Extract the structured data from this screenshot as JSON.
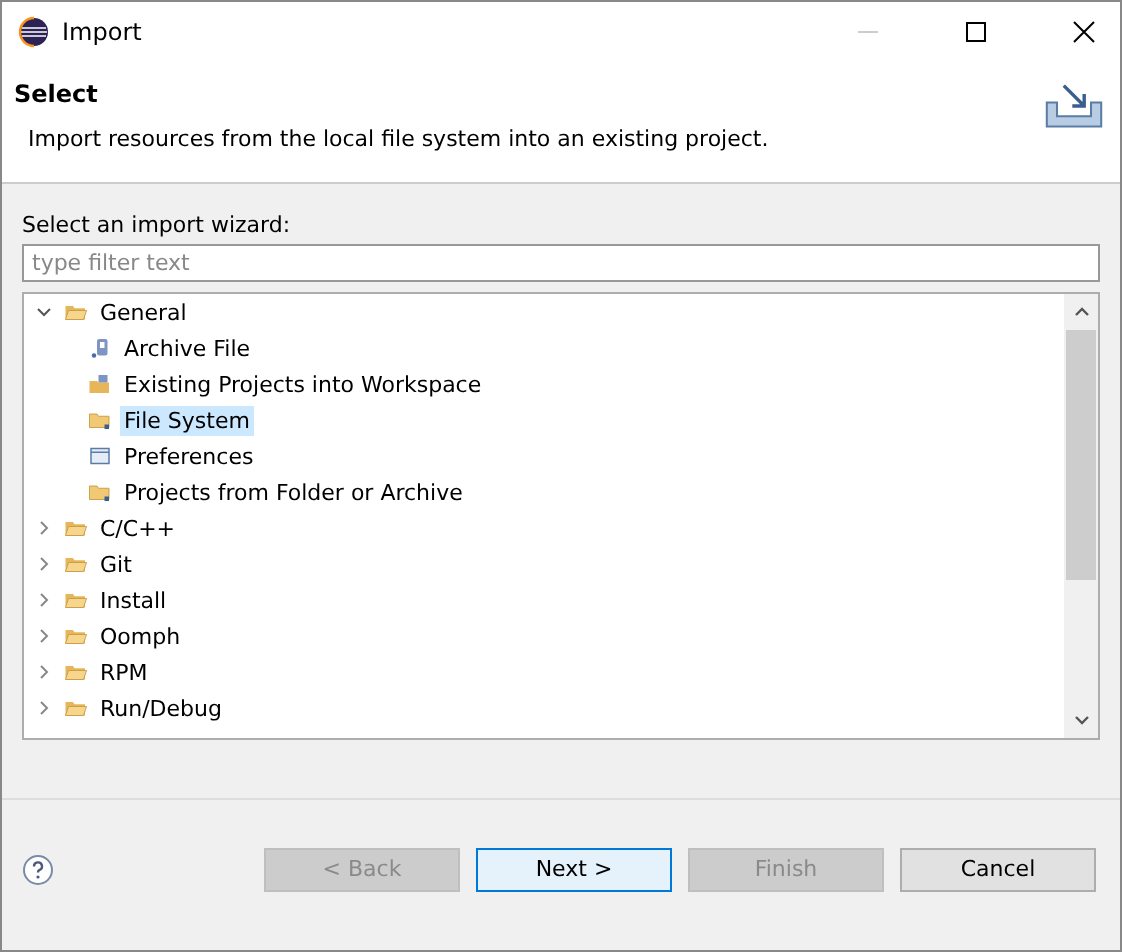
{
  "window": {
    "title": "Import"
  },
  "header": {
    "title": "Select",
    "description": "Import resources from the local file system into an existing project."
  },
  "wizard_label": "Select an import wizard:",
  "filter": {
    "placeholder": "type filter text"
  },
  "tree": [
    {
      "label": "General",
      "expanded": true,
      "selected": false,
      "children": [
        {
          "label": "Archive File",
          "kind": "archive",
          "selected": false
        },
        {
          "label": "Existing Projects into Workspace",
          "kind": "project",
          "selected": false
        },
        {
          "label": "File System",
          "kind": "folder",
          "selected": true
        },
        {
          "label": "Preferences",
          "kind": "preferences",
          "selected": false
        },
        {
          "label": "Projects from Folder or Archive",
          "kind": "folder",
          "selected": false
        }
      ]
    },
    {
      "label": "C/C++",
      "expanded": false,
      "selected": false
    },
    {
      "label": "Git",
      "expanded": false,
      "selected": false
    },
    {
      "label": "Install",
      "expanded": false,
      "selected": false
    },
    {
      "label": "Oomph",
      "expanded": false,
      "selected": false
    },
    {
      "label": "RPM",
      "expanded": false,
      "selected": false
    },
    {
      "label": "Run/Debug",
      "expanded": false,
      "selected": false
    }
  ],
  "buttons": [
    {
      "label": "< Back",
      "disabled": true,
      "default": false
    },
    {
      "label": "Next >",
      "disabled": false,
      "default": true
    },
    {
      "label": "Finish",
      "disabled": true,
      "default": false
    },
    {
      "label": "Cancel",
      "disabled": false,
      "default": false
    }
  ]
}
